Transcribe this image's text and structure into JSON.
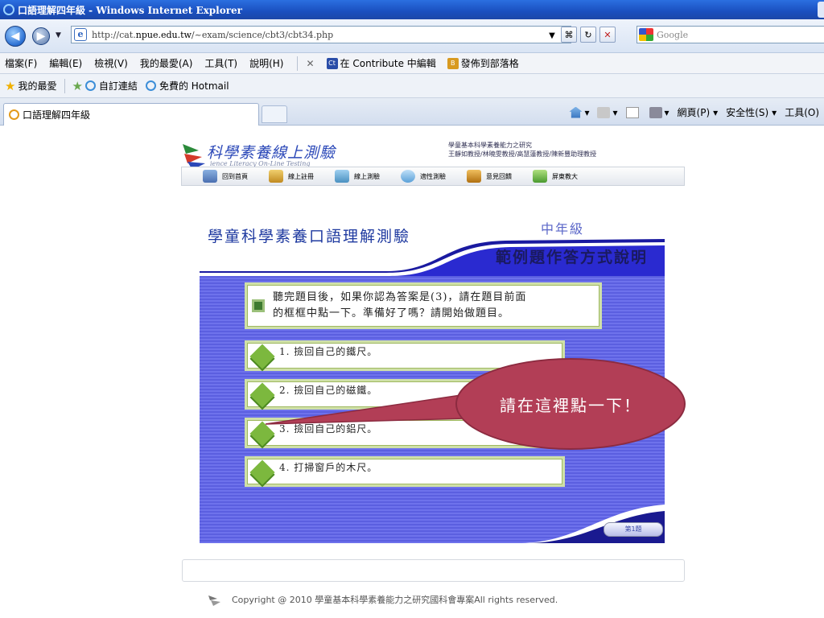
{
  "window": {
    "title": "口語理解四年級 - Windows Internet Explorer"
  },
  "address": {
    "url_prefix": "http://cat.",
    "url_domain": "npue.edu.tw",
    "url_path": "/~exam/science/cbt3/cbt34.php"
  },
  "search": {
    "placeholder": "Google"
  },
  "menu": {
    "items": [
      "檔案(F)",
      "編輯(E)",
      "檢視(V)",
      "我的最愛(A)",
      "工具(T)",
      "說明(H)"
    ],
    "contribute_edit": "在 Contribute 中編輯",
    "publish_blog": "發佈到部落格"
  },
  "favorites": {
    "label": "我的最愛",
    "custom_links": "自訂連結",
    "hotmail": "免費的 Hotmail"
  },
  "tab": {
    "label": "口語理解四年級"
  },
  "commands": {
    "page": "網頁(P)",
    "safety": "安全性(S)",
    "tools": "工具(O)"
  },
  "site": {
    "logo_title": "科學素養線上測驗",
    "logo_subtitle": "ience Literacy On-Line Testing",
    "project_line1": "學童基本科學素養能力之研究",
    "project_line2": "王靜如教授/林曉雯教授/高慧蓮教授/陳新豐助理教授",
    "nav": [
      "回到首頁",
      "線上註冊",
      "線上測驗",
      "適性測驗",
      "意見回饋",
      "屏東教大"
    ]
  },
  "test": {
    "title": "學童科學素養口語理解測驗",
    "grade": "中年級",
    "banner": "範例題作答方式說明",
    "instruction_line1": "聽完題目後，如果你認為答案是(3)，請在題目前面",
    "instruction_line2": "的框框中點一下。準備好了嗎？請開始做題目。",
    "options": [
      {
        "label": "1. 撿回自己的鐵尺。"
      },
      {
        "label": "2. 撿回自己的磁鐵。"
      },
      {
        "label": "3. 撿回自己的鋁尺。"
      },
      {
        "label": "4. 打掃窗戶的木尺。"
      }
    ],
    "next_label": "第1題"
  },
  "callout": {
    "text": "請在這裡點一下！"
  },
  "footer": {
    "copyright": "Copyright @ 2010 學童基本科學素養能力之研究國科會專案All rights reserved."
  },
  "colors": {
    "accent_blue": "#5b5fe0",
    "callout": "#b23e56",
    "option_green": "#7cb83e"
  }
}
